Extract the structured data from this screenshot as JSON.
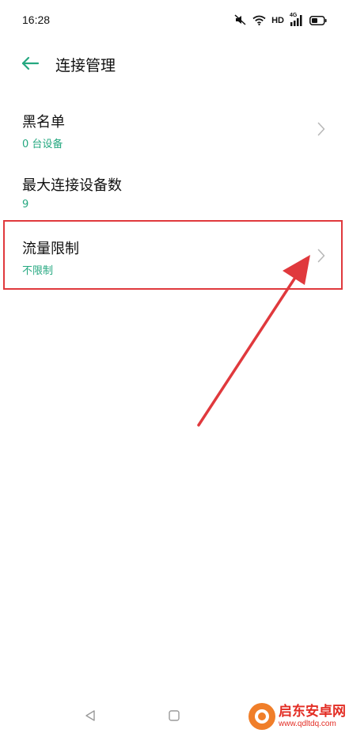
{
  "status_bar": {
    "time": "16:28",
    "network_label": "HD",
    "signal_label": "4G"
  },
  "header": {
    "title": "连接管理",
    "back_icon": "arrow-left-icon"
  },
  "settings": {
    "items": [
      {
        "title": "黑名单",
        "subtitle": "0 台设备",
        "has_chevron": true
      },
      {
        "title": "最大连接设备数",
        "subtitle": "9",
        "has_chevron": false
      },
      {
        "title": "流量限制",
        "subtitle": "不限制",
        "has_chevron": true
      }
    ]
  },
  "annotation": {
    "highlight_color": "#e0393d"
  },
  "colors": {
    "accent": "#25a880",
    "text_primary": "#111111",
    "chevron": "#b8b8b8"
  },
  "watermark": {
    "name": "启东安卓网",
    "url": "www.qdltdq.com"
  }
}
